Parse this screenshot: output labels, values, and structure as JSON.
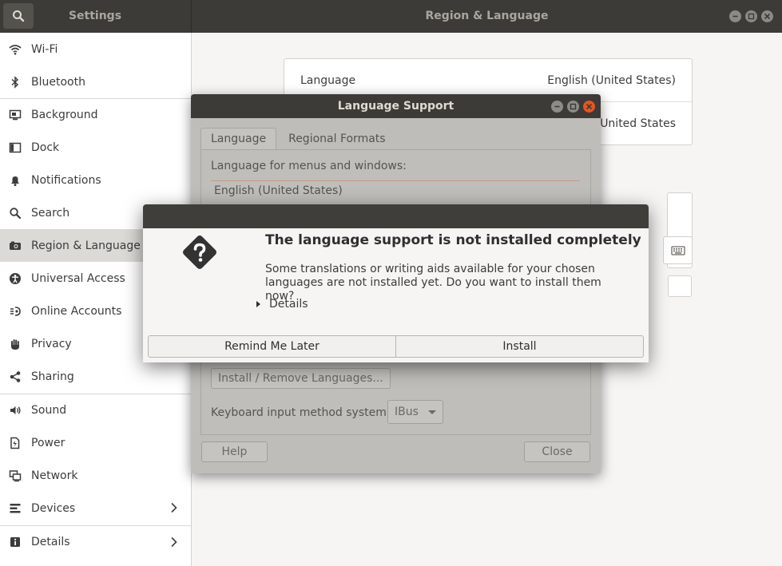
{
  "titlebar": {
    "left_title": "Settings",
    "right_title": "Region & Language"
  },
  "sidebar": {
    "items": [
      {
        "label": "Wi-Fi",
        "icon": "wifi-icon"
      },
      {
        "label": "Bluetooth",
        "icon": "bluetooth-icon"
      },
      {
        "label": "Background",
        "icon": "background-icon"
      },
      {
        "label": "Dock",
        "icon": "dock-icon"
      },
      {
        "label": "Notifications",
        "icon": "bell-icon"
      },
      {
        "label": "Search",
        "icon": "search-icon"
      },
      {
        "label": "Region & Language",
        "icon": "camera-icon"
      },
      {
        "label": "Universal Access",
        "icon": "accessibility-icon"
      },
      {
        "label": "Online Accounts",
        "icon": "online-accounts-icon"
      },
      {
        "label": "Privacy",
        "icon": "hand-icon"
      },
      {
        "label": "Sharing",
        "icon": "share-icon"
      },
      {
        "label": "Sound",
        "icon": "speaker-icon"
      },
      {
        "label": "Power",
        "icon": "power-icon"
      },
      {
        "label": "Network",
        "icon": "network-icon"
      },
      {
        "label": "Devices",
        "icon": "devices-icon"
      },
      {
        "label": "Details",
        "icon": "info-icon"
      }
    ]
  },
  "region": {
    "language_label": "Language",
    "language_value": "English (United States)",
    "formats_value": "United States"
  },
  "language_support": {
    "title": "Language Support",
    "tabs": [
      "Language",
      "Regional Formats"
    ],
    "menus_label": "Language for menus and windows:",
    "list_items": [
      "English (United States)"
    ],
    "install_remove_button": "Install / Remove Languages...",
    "keyboard_label": "Keyboard input method system:",
    "keyboard_value": "IBus",
    "help_button": "Help",
    "close_button": "Close"
  },
  "dialog": {
    "heading": "The language support is not installed completely",
    "text": "Some translations or writing aids available for your chosen languages are not installed yet. Do you want to install them now?",
    "details_label": "Details",
    "remind_button": "Remind Me Later",
    "install_button": "Install"
  }
}
